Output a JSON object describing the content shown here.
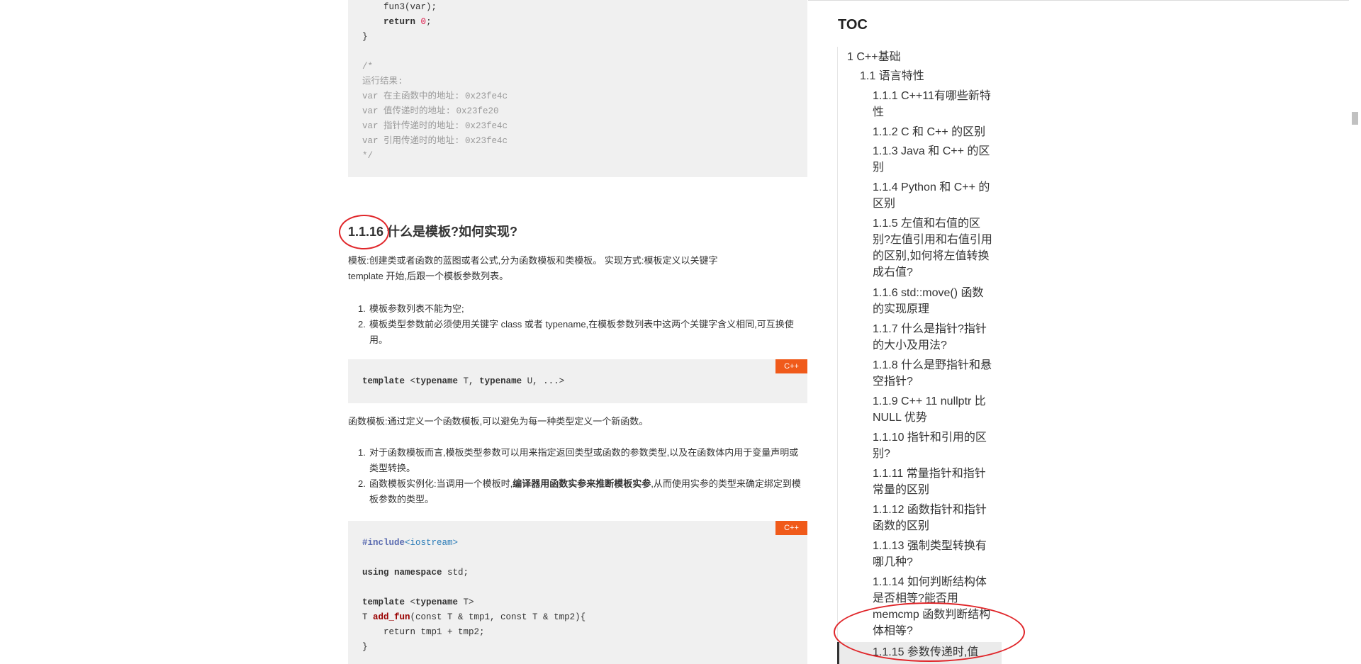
{
  "article": {
    "code_block_1": [
      "    fun3(var);",
      "    return 0;",
      "}",
      "",
      "/*",
      "运行结果:",
      "var 在主函数中的地址: 0x23fe4c",
      "var 值传递时的地址: 0x23fe20",
      "var 指针传递时的地址: 0x23fe4c",
      "var 引用传递时的地址: 0x23fe4c",
      "*/"
    ],
    "heading_number": "1.1.16",
    "heading_text": " 什么是模板?如何实现?",
    "para_1_line_1": "模板:创建类或者函数的蓝图或者公式,分为函数模板和类模板。 实现方式:模板定义以关键字",
    "para_1_line_2": "template 开始,后跟一个模板参数列表。",
    "list_1": [
      {
        "num": "1.",
        "text": "模板参数列表不能为空;"
      },
      {
        "num": "2.",
        "text": "模板类型参数前必须使用关键字 class 或者 typename,在模板参数列表中这两个关键字含义相同,可互换使用。"
      }
    ],
    "code_block_2": {
      "lang": "C++",
      "line": "template <typename T, typename U, ...>"
    },
    "para_2": "函数模板:通过定义一个函数模板,可以避免为每一种类型定义一个新函数。",
    "list_2": [
      {
        "num": "1.",
        "text": "对于函数模板而言,模板类型参数可以用来指定返回类型或函数的参数类型,以及在函数体内用于变量声明或类型转换。"
      },
      {
        "num": "2.",
        "text_before": "函数模板实例化:当调用一个模板时,",
        "text_bold": "编译器用函数实参来推断模板实参",
        "text_after": ",从而使用实参的类型来确定绑定到模板参数的类型。"
      }
    ],
    "code_block_3": {
      "lang": "C++",
      "lines": [
        "#include<iostream>",
        "",
        "using namespace std;",
        "",
        "template <typename T>",
        "T add_fun(const T & tmp1, const T & tmp2){",
        "    return tmp1 + tmp2;",
        "}"
      ]
    }
  },
  "toc": {
    "title": "TOC",
    "items": [
      {
        "level": 1,
        "label": "1 C++基础"
      },
      {
        "level": 2,
        "label": "1.1 语言特性"
      },
      {
        "level": 3,
        "label": "1.1.1 C++11有哪些新特性"
      },
      {
        "level": 3,
        "label": "1.1.2 C 和 C++ 的区别"
      },
      {
        "level": 3,
        "label": "1.1.3 Java 和 C++ 的区别"
      },
      {
        "level": 3,
        "label": "1.1.4 Python 和 C++ 的区别"
      },
      {
        "level": 3,
        "label": "1.1.5 左值和右值的区别?左值引用和右值引用的区别,如何将左值转换成右值?"
      },
      {
        "level": 3,
        "label": "1.1.6 std::move() 函数的实现原理"
      },
      {
        "level": 3,
        "label": "1.1.7 什么是指针?指针的大小及用法?"
      },
      {
        "level": 3,
        "label": "1.1.8 什么是野指针和悬空指针?"
      },
      {
        "level": 3,
        "label": "1.1.9 C++ 11 nullptr 比 NULL 优势"
      },
      {
        "level": 3,
        "label": "1.1.10 指针和引用的区别?"
      },
      {
        "level": 3,
        "label": "1.1.11 常量指针和指针常量的区别"
      },
      {
        "level": 3,
        "label": "1.1.12 函数指针和指针函数的区别"
      },
      {
        "level": 3,
        "label": "1.1.13 强制类型转换有哪几种?"
      },
      {
        "level": 3,
        "label": "1.1.14 如何判断结构体是否相等?能否用 memcmp 函数判断结构体相等?"
      },
      {
        "level": 3,
        "label": "1.1.15 参数传递时,值"
      }
    ]
  },
  "colors": {
    "accent_badge": "#f05a1a",
    "annotation_red": "#e0262a",
    "code_bg": "#f0f0f0"
  }
}
